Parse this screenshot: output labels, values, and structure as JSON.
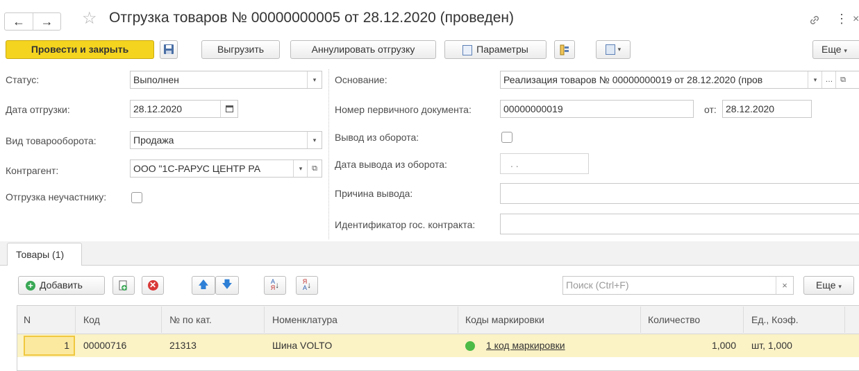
{
  "window": {
    "title": "Отгрузка товаров № 00000000005 от 28.12.2020 (проведен)",
    "nav_back": "←",
    "nav_forward": "→"
  },
  "toolbar": {
    "post_close": "Провести и закрыть",
    "export": "Выгрузить",
    "cancel_shipment": "Аннулировать отгрузку",
    "params": "Параметры",
    "more": "Еще"
  },
  "form": {
    "status_label": "Статус:",
    "status_value": "Выполнен",
    "ship_date_label": "Дата отгрузки:",
    "ship_date_value": "28.12.2020",
    "turnover_label": "Вид товарооборота:",
    "turnover_value": "Продажа",
    "counterparty_label": "Контрагент:",
    "counterparty_value": "ООО \"1С-РАРУС ЦЕНТР РА",
    "nonparticipant_label": "Отгрузка неучастнику:",
    "basis_label": "Основание:",
    "basis_value": "Реализация товаров № 00000000019 от 28.12.2020 (пров",
    "primary_doc_label": "Номер первичного документа:",
    "primary_doc_value": "00000000019",
    "from_label": "от:",
    "from_value": "28.12.2020",
    "withdraw_label": "Вывод из оборота:",
    "withdraw_date_label": "Дата вывода из оборота:",
    "withdraw_date_value": ". .",
    "reason_label": "Причина вывода:",
    "contract_id_label": "Идентификатор гос. контракта:"
  },
  "tabs": [
    {
      "label": "Товары (1)"
    }
  ],
  "table_toolbar": {
    "add": "Добавить",
    "search_placeholder": "Поиск (Ctrl+F)",
    "more": "Еще"
  },
  "table": {
    "columns": [
      "N",
      "Код",
      "№ по кат.",
      "Номенклатура",
      "Коды маркировки",
      "Количество",
      "Ед., Коэф."
    ],
    "rows": [
      {
        "n": "1",
        "code": "00000716",
        "cat": "21313",
        "nomenclature": "Шина VOLTO",
        "marking": "1 код маркировки",
        "qty": "1,000",
        "unit": "шт, 1,000"
      }
    ]
  },
  "colors": {
    "primary_button": "#f5d41f",
    "selected_row": "#fbf2c6",
    "status_ok": "#4cbb47",
    "tab_bar": "#f2f2f2"
  }
}
